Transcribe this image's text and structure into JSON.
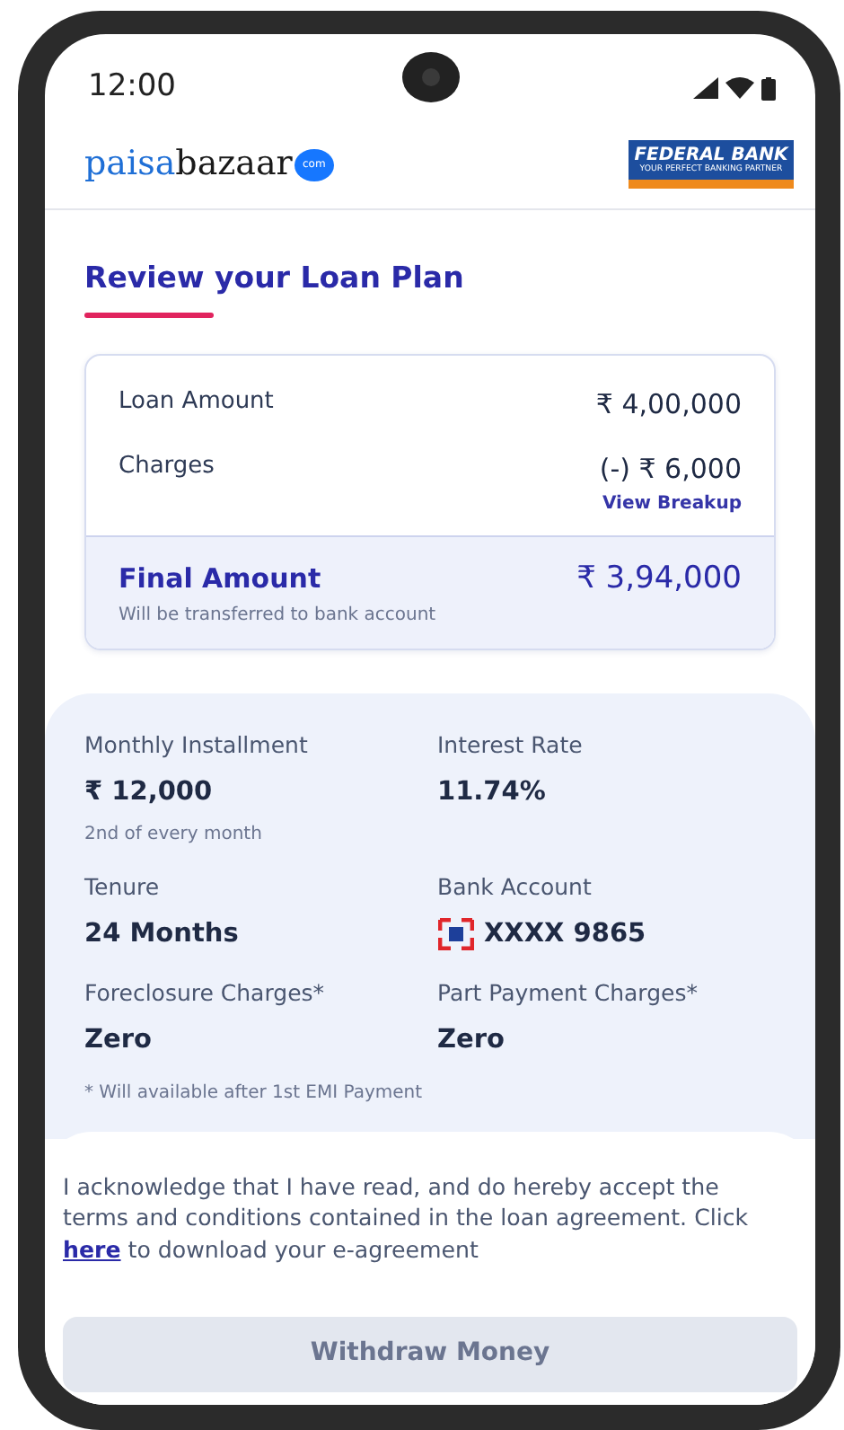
{
  "status_bar": {
    "time": "12:00"
  },
  "header": {
    "brand": {
      "part_1": "paisa",
      "part_2": "bazaar",
      "badge": "com"
    },
    "partner": {
      "name": "FEDERAL BANK",
      "tagline": "YOUR PERFECT BANKING PARTNER"
    }
  },
  "title": "Review your Loan Plan",
  "summary": {
    "rows": [
      {
        "label": "Loan Amount",
        "value": "₹ 4,00,000"
      },
      {
        "label": "Charges",
        "value": "(-) ₹ 6,000",
        "link": "View Breakup"
      }
    ],
    "final": {
      "label": "Final Amount",
      "value": "₹ 3,94,000",
      "note": "Will be transferred to bank account"
    }
  },
  "details": [
    {
      "label": "Monthly Installment",
      "value": "₹ 12,000",
      "note": "2nd of every month"
    },
    {
      "label": "Interest Rate",
      "value": "11.74%"
    },
    {
      "label": "Tenure",
      "value": "24 Months"
    },
    {
      "label": "Bank Account",
      "value": "XXXX 9865",
      "bank_icon": true
    },
    {
      "label": "Foreclosure Charges*",
      "value": "Zero"
    },
    {
      "label": "Part Payment Charges*",
      "value": "Zero"
    }
  ],
  "details_footnote": "* Will available after 1st EMI Payment",
  "agreement": {
    "text_before": "I acknowledge that I have read, and do hereby accept the terms and conditions contained in the loan agreement. Click",
    "link": "here",
    "text_after": "to download your e-agreement"
  },
  "primary_button": {
    "label": "Withdraw Money",
    "disabled": true
  }
}
